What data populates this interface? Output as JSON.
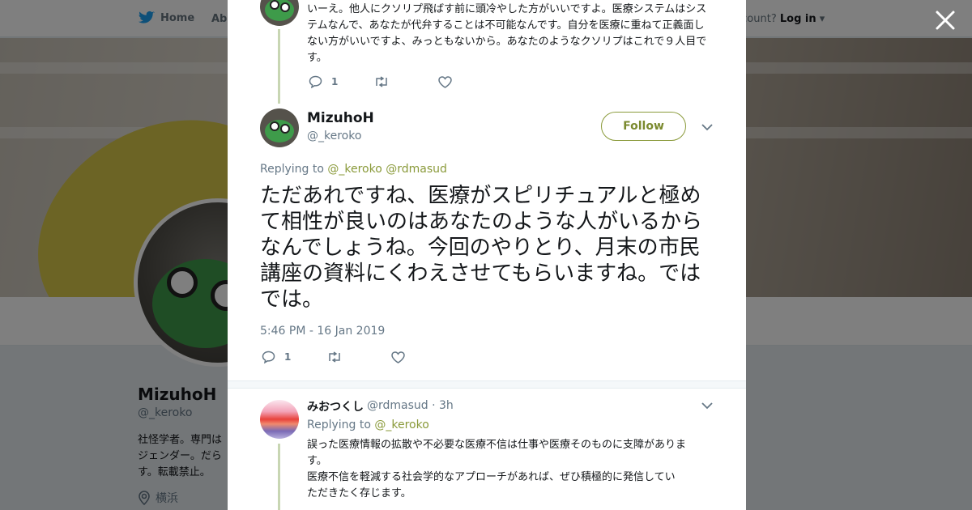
{
  "colors": {
    "accent": "#8a9a3a",
    "twitter_blue": "#1da1f2",
    "thread_line": "#c8d6b3"
  },
  "nav": {
    "home": "Home",
    "about": "Abo",
    "account_prefix": "ccount?",
    "login": "Log in",
    "twitter_icon": "twitter-bird-icon"
  },
  "profile_bg": {
    "name": "MizuhoH",
    "handle": "@_keroko",
    "bio": "社怪学者。専門は\nジェンダー。だら\nす。転載禁止。",
    "location": "横浜"
  },
  "thread_prev": {
    "text": "いーえ。他人にクソリプ飛ばす前に頭冷やした方がいいですよ。医療システムはシステムなんで、あなたが代弁することは不可能なんです。自分を医療に重ねて正義面しない方がいいですよ、みっともないから。あなたのようなクソリプはこれで９人目です。",
    "reply_count": "1"
  },
  "main_tweet": {
    "name": "MizuhoH",
    "handle": "@_keroko",
    "follow": "Follow",
    "replying_label": "Replying to",
    "replying_to": "@_keroko @rdmasud",
    "text": "ただあれですね、医療がスピリチュアルと極めて相性が良いのはあなたのような人がいるからなんでしょうね。今回のやりとり、月末の市民講座の資料にくわえさせてもらいますね。ではでは。",
    "time": "5:46 PM - 16 Jan 2019",
    "reply_count": "1"
  },
  "reply": {
    "name": "みおつくし",
    "meta": "@rdmasud · 3h",
    "replying_label": "Replying to",
    "replying_to": "@_keroko",
    "text1": "誤った医療情報の拡散や不必要な医療不信は仕事や医療そのものに支障がありま",
    "text2": "す。",
    "text3": "医療不信を軽減する社会学的なアプローチがあれば、ぜひ積極的に発信してい",
    "text4": "ただきたく存じます。"
  }
}
